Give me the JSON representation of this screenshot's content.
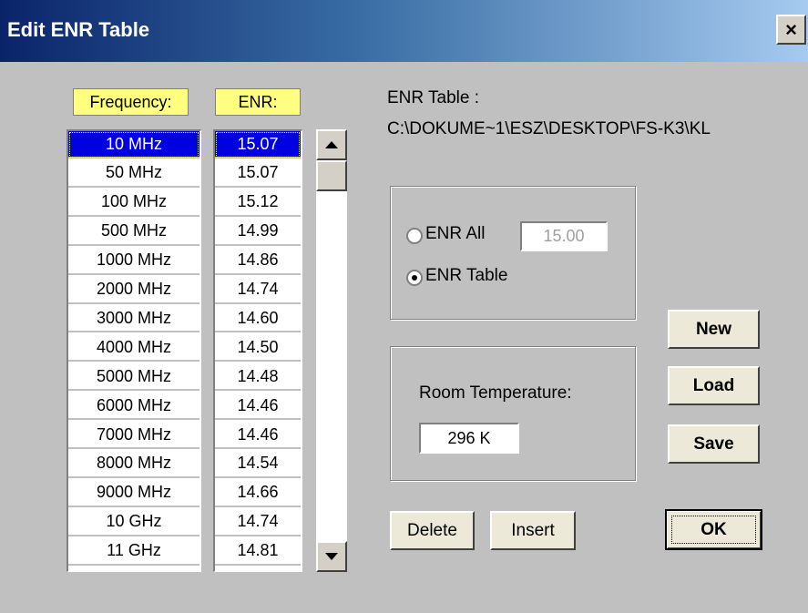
{
  "window": {
    "title": "Edit  ENR Table",
    "close_glyph": "×"
  },
  "table": {
    "frequency_header": "Frequency:",
    "enr_header": "ENR:",
    "selected_index": 0,
    "rows": [
      {
        "frequency": "10 MHz",
        "enr": "15.07"
      },
      {
        "frequency": "50 MHz",
        "enr": "15.07"
      },
      {
        "frequency": "100 MHz",
        "enr": "15.12"
      },
      {
        "frequency": "500 MHz",
        "enr": "14.99"
      },
      {
        "frequency": "1000 MHz",
        "enr": "14.86"
      },
      {
        "frequency": "2000 MHz",
        "enr": "14.74"
      },
      {
        "frequency": "3000 MHz",
        "enr": "14.60"
      },
      {
        "frequency": "4000 MHz",
        "enr": "14.50"
      },
      {
        "frequency": "5000 MHz",
        "enr": "14.48"
      },
      {
        "frequency": "6000 MHz",
        "enr": "14.46"
      },
      {
        "frequency": "7000 MHz",
        "enr": "14.46"
      },
      {
        "frequency": "8000 MHz",
        "enr": "14.54"
      },
      {
        "frequency": "9000 MHz",
        "enr": "14.66"
      },
      {
        "frequency": "10 GHz",
        "enr": "14.74"
      },
      {
        "frequency": "11 GHz",
        "enr": "14.81"
      }
    ]
  },
  "enr_table_info": {
    "label": "ENR Table :",
    "path": "C:\\DOKUME~1\\ESZ\\DESKTOP\\FS-K3\\KL"
  },
  "enr_mode": {
    "enr_all_label": "ENR All",
    "enr_all_value": "15.00",
    "enr_table_label": "ENR Table",
    "selected": "ENR Table"
  },
  "room_temperature": {
    "label": "Room Temperature:",
    "value": "296 K"
  },
  "buttons": {
    "new": "New",
    "load": "Load",
    "save": "Save",
    "delete": "Delete",
    "insert": "Insert",
    "ok": "OK"
  },
  "colors": {
    "header_bg": "#ffff80",
    "selection_bg": "#0000e0",
    "dialog_bg": "#c0c0c0"
  }
}
